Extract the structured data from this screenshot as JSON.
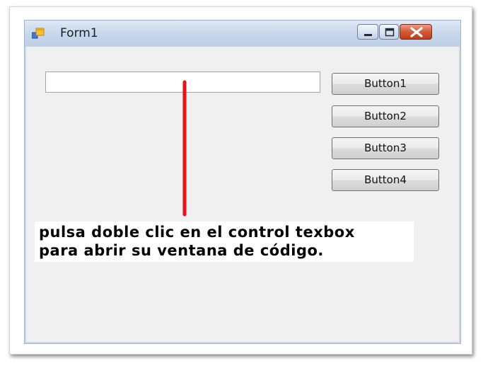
{
  "window": {
    "title": "Form1",
    "controls": {
      "minimize": "minimize-icon",
      "maximize": "maximize-icon",
      "close": "close-icon"
    }
  },
  "form": {
    "textbox_value": "",
    "buttons": [
      "Button1",
      "Button2",
      "Button3",
      "Button4"
    ]
  },
  "annotation": {
    "line1": "pulsa doble clic en el control texbox",
    "line2": "para abrir su ventana de código.",
    "arrow_color": "#e8121a"
  },
  "colors": {
    "titlebar": "#c8d8ec",
    "client": "#f0f0f0",
    "close_button": "#d35a37"
  }
}
